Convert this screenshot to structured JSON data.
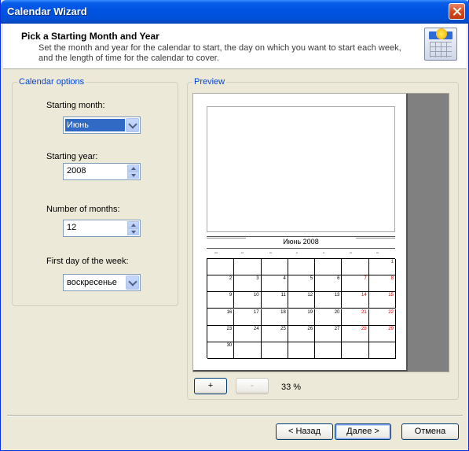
{
  "window": {
    "title": "Calendar Wizard"
  },
  "header": {
    "title": "Pick a Starting Month and Year",
    "description": "Set the month and year for the calendar to start, the day on which you want to start each week, and the length of time for the calendar to cover."
  },
  "options": {
    "legend": "Calendar options",
    "starting_month_label": "Starting month:",
    "starting_month_value": "Июнь",
    "starting_year_label": "Starting year:",
    "starting_year_value": "2008",
    "number_of_months_label": "Number of months:",
    "number_of_months_value": "12",
    "first_day_label": "First day of the week:",
    "first_day_value": "воскресенье"
  },
  "preview": {
    "legend": "Preview",
    "month_title": "Июнь 2008",
    "zoom_in_label": "+",
    "zoom_out_label": "-",
    "zoom_level": "33 %",
    "calendar_days": [
      "",
      "",
      "",
      "",
      "",
      "",
      "1",
      "2",
      "3",
      "4",
      "5",
      "6",
      "7",
      "8",
      "9",
      "10",
      "11",
      "12",
      "13",
      "14",
      "15",
      "16",
      "17",
      "18",
      "19",
      "20",
      "21",
      "22",
      "23",
      "24",
      "25",
      "26",
      "27",
      "28",
      "29",
      "30",
      "",
      "",
      "",
      "",
      "",
      ""
    ]
  },
  "footer": {
    "back_label": "< Назад",
    "next_label": "Далее >",
    "cancel_label": "Отмена"
  }
}
